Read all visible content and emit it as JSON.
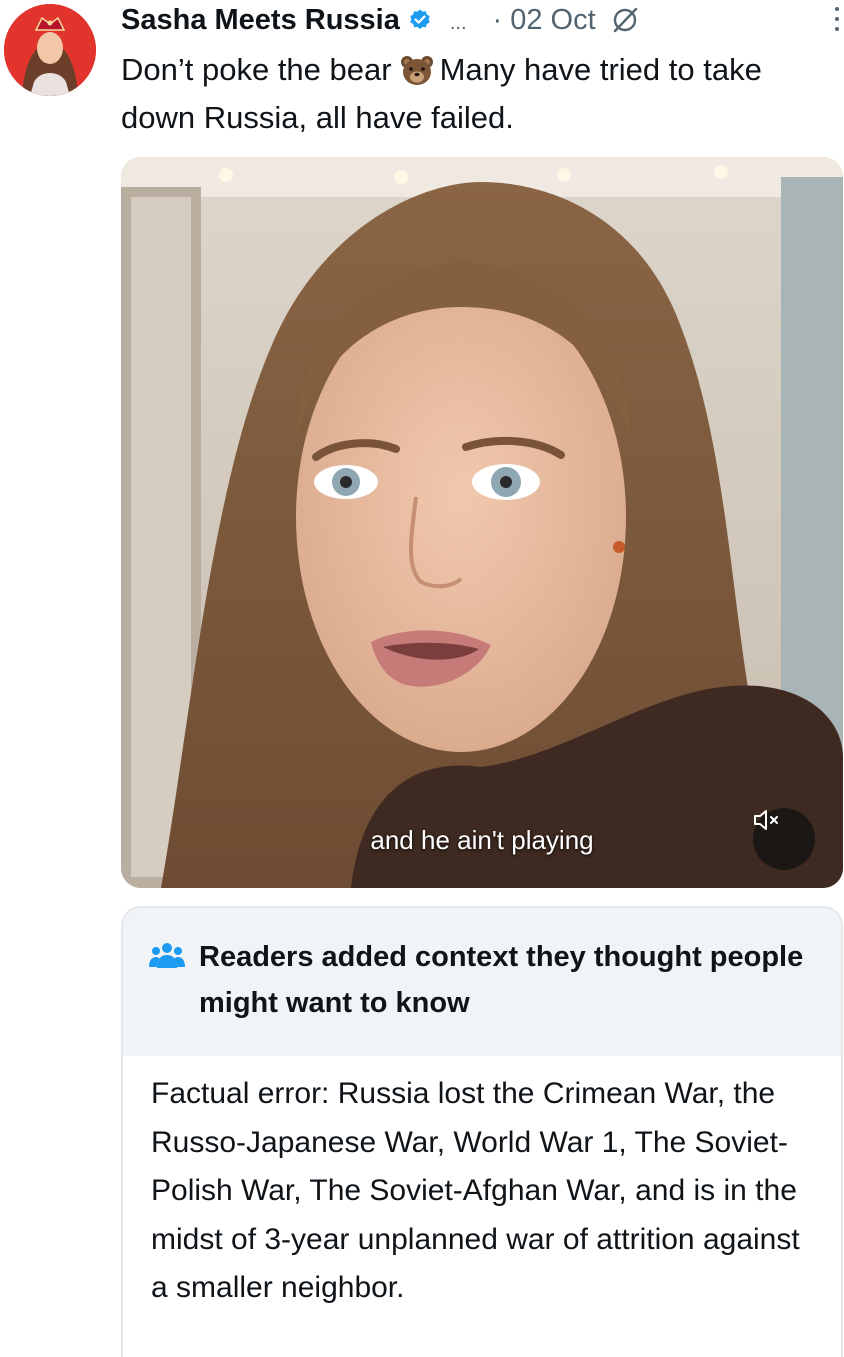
{
  "post": {
    "author": "Sasha Meets Russia",
    "ellipsis": "...",
    "date": "· 02 Oct",
    "text_before_emoji": "Don’t poke the bear",
    "text_after_emoji": "Many have tried to take down Russia, all have failed."
  },
  "media": {
    "caption": "and he ain't playing"
  },
  "community_note": {
    "title": "Readers added context they thought people might want to know",
    "body": "Factual error: Russia lost the Crimean War, the Russo-Japanese War, World War 1, The Soviet-Polish War, The Soviet-Afghan War, and is in the midst of 3-year unplanned war of attrition against a smaller neighbor."
  },
  "icons": {
    "verified": "verified-badge-icon",
    "grok": "grok-icon",
    "more": "more-vertical-icon",
    "bear": "bear-face-emoji",
    "mute": "speaker-muted-icon",
    "people": "people-icon"
  },
  "colors": {
    "verified_blue": "#1d9bf0",
    "secondary_text": "#536471",
    "note_header_bg": "#f1f4f7",
    "note_icon_blue": "#1d9bf0",
    "avatar_bg": "#e0342c"
  }
}
